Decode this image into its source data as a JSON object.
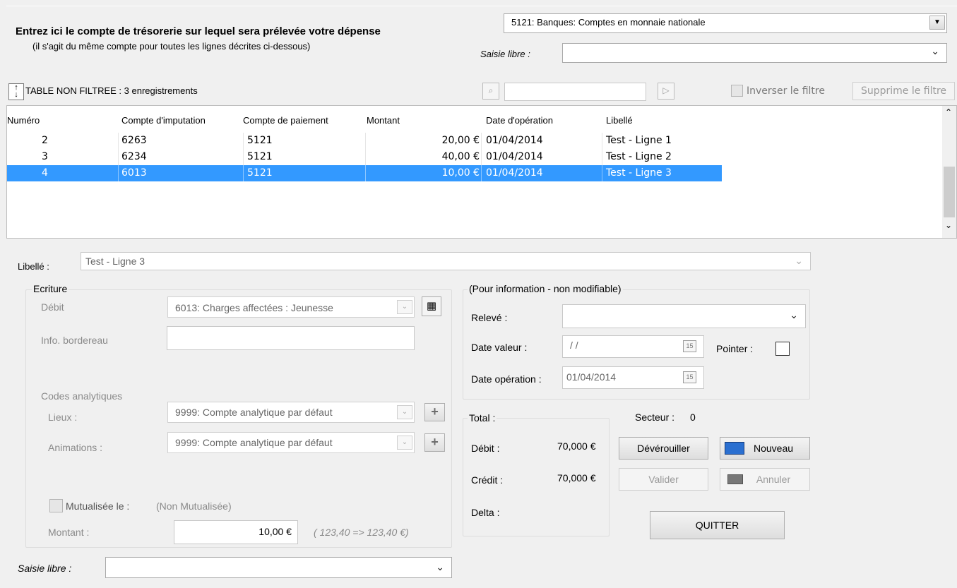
{
  "header": {
    "prompt_line1": "Entrez ici le compte de trésorerie sur lequel sera prélevée votre dépense",
    "prompt_line2": "(il s'agit du même compte pour toutes les lignes décrites ci-dessous)",
    "account_value": "5121: Banques: Comptes en monnaie nationale",
    "free_entry_label": "Saisie libre :",
    "free_entry_value": ""
  },
  "filter_bar": {
    "status": "TABLE NON FILTREE : 3 enregistrements",
    "filter_value": "",
    "invert_label": "Inverser le filtre",
    "remove_label": "Supprime le filtre"
  },
  "table": {
    "columns": [
      "Numéro",
      "Compte d'imputation",
      "Compte de paiement",
      "Montant",
      "Date d'opération",
      "Libellé"
    ],
    "rows": [
      {
        "numero": "2",
        "imputation": "6263",
        "paiement": "5121",
        "montant": "20,00 €",
        "date": "01/04/2014",
        "libelle": "Test - Ligne 1"
      },
      {
        "numero": "3",
        "imputation": "6234",
        "paiement": "5121",
        "montant": "40,00 €",
        "date": "01/04/2014",
        "libelle": "Test - Ligne 2"
      },
      {
        "numero": "4",
        "imputation": "6013",
        "paiement": "5121",
        "montant": "10,00 €",
        "date": "01/04/2014",
        "libelle": "Test - Ligne 3"
      }
    ],
    "selected_row": 2
  },
  "form": {
    "libelle_label": "Libellé :",
    "libelle_value": "Test - Ligne 3",
    "ecriture": {
      "title": "Ecriture",
      "debit_label": "Débit",
      "debit_value": "6013: Charges affectées : Jeunesse",
      "bordereau_label": "Info. bordereau",
      "bordereau_value": "",
      "codes_label": "Codes analytiques",
      "lieux_label": "Lieux :",
      "lieux_value": "9999: Compte analytique par défaut",
      "animations_label": "Animations :",
      "animations_value": "9999: Compte analytique par défaut",
      "mutualisee_label": "Mutualisée le :",
      "mutualisee_value": "(Non Mutualisée)",
      "montant_label": "Montant :",
      "montant_value": "10,00 €",
      "montant_hint": "( 123,40 => 123,40 €)"
    },
    "info": {
      "title": "(Pour information - non modifiable)",
      "releve_label": "Relevé :",
      "releve_value": "",
      "date_valeur_label": "Date valeur :",
      "date_valeur_value": "/ /",
      "pointer_label": "Pointer :",
      "date_operation_label": "Date opération :",
      "date_operation_value": "01/04/2014"
    },
    "total": {
      "title": "Total :",
      "debit_label": "Débit :",
      "debit_value": "70,000 €",
      "credit_label": "Crédit :",
      "credit_value": "70,000 €",
      "delta_label": "Delta :",
      "delta_value": ""
    },
    "secteur_label": "Secteur :",
    "secteur_value": "0",
    "buttons": {
      "deverouiller": "Dévérouiller",
      "nouveau": "Nouveau",
      "valider": "Valider",
      "annuler": "Annuler",
      "quitter": "QUITTER"
    },
    "free_entry_label": "Saisie libre :",
    "free_entry_value": ""
  },
  "colors": {
    "selection": "#3399ff",
    "background": "#f0f0f0"
  }
}
